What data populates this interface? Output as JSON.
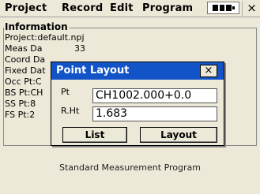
{
  "menubar": {
    "items": [
      "Project",
      "Record",
      "Edit",
      "Program"
    ],
    "battery_icon": "battery-icon",
    "close_label": "×"
  },
  "info": {
    "title": "Information",
    "lines": [
      "Project:default.npj",
      "Meas Da",
      "Coord Da",
      "Fixed Dat",
      "Occ Pt:C",
      "BS Pt:CH",
      "SS Pt:8",
      "FS Pt:2"
    ],
    "peek_text": "33"
  },
  "footer": {
    "text": "Standard Measurement Program"
  },
  "dialog": {
    "title": "Point Layout",
    "close_label": "×",
    "pt_label": "Pt",
    "pt_value": "CH1002.000+0.0",
    "rht_label": "R.Ht",
    "rht_value": "1.683",
    "list_button": "List",
    "layout_button": "Layout"
  },
  "colors": {
    "titlebar": "#1254c8",
    "background": "#ece9d8"
  }
}
